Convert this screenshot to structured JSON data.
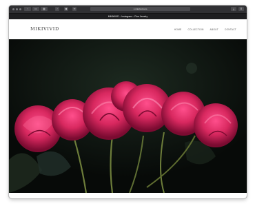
{
  "browser": {
    "url": "mikivivid.com",
    "tab_title": "MIKIVIVID – Instagram – Fine Jewelry",
    "toolbar_icons": [
      "back-icon",
      "forward-icon",
      "share-icon",
      "reader-icon",
      "tabs-icon",
      "download-icon"
    ]
  },
  "site": {
    "logo": "MIKIVIVID",
    "nav": [
      "HOME",
      "COLLECTION",
      "ABOUT",
      "CONTACT"
    ]
  },
  "hero": {
    "image_subject": "pink roses"
  },
  "colors": {
    "rose": "#d8285f",
    "rose_dark": "#8c0f38",
    "stem": "#6d7d3a",
    "background": "#0b0f0c"
  }
}
